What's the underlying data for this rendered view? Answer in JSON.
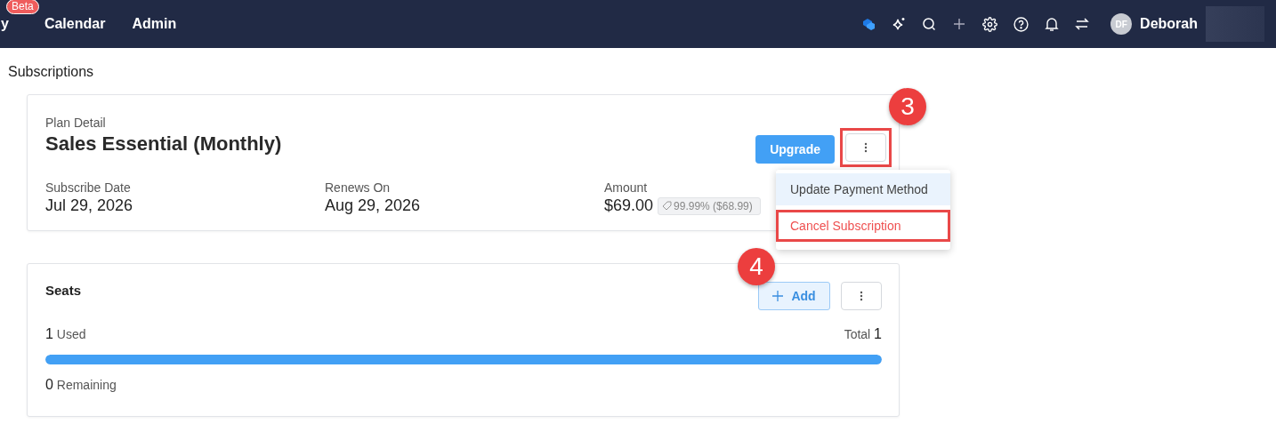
{
  "navbar": {
    "items": [
      {
        "label": "y",
        "badge": "Beta"
      },
      {
        "label": "Calendar"
      },
      {
        "label": "Admin"
      }
    ],
    "user": {
      "initials": "DF",
      "name": "Deborah"
    }
  },
  "page_title": "Subscriptions",
  "plan": {
    "caption": "Plan Detail",
    "name": "Sales Essential (Monthly)",
    "upgrade": "Upgrade",
    "more_outlined": true,
    "fields": [
      {
        "label": "Subscribe Date",
        "value": "Jul 29, 2026"
      },
      {
        "label": "Renews On",
        "value": "Aug 29, 2026"
      },
      {
        "label": "Amount",
        "value": "$69.00",
        "tag": "99.99% ($68.99)"
      }
    ],
    "menu": [
      {
        "label": "Update Payment Method",
        "kind": "normal",
        "selected": true,
        "outlined": false
      },
      {
        "label": "Cancel Subscription",
        "kind": "danger",
        "selected": false,
        "outlined": true
      }
    ]
  },
  "seats": {
    "title": "Seats",
    "add": "Add",
    "used": "1",
    "used_label": "Used",
    "total_label": "Total",
    "total": "1",
    "level": 1,
    "remaining": "0",
    "remaining_label": "Remaining"
  },
  "annotations": [
    {
      "number": "3"
    },
    {
      "number": "4"
    }
  ]
}
